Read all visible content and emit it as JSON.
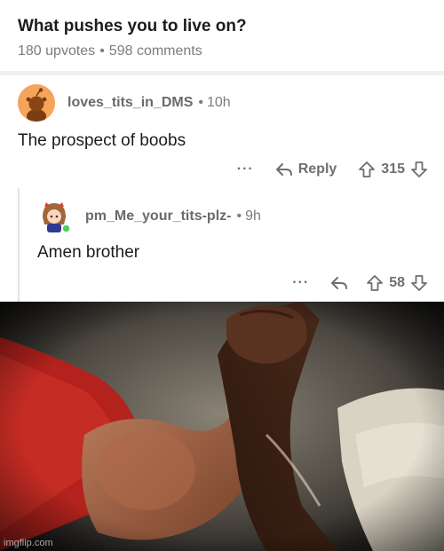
{
  "post": {
    "title": "What pushes you to live on?",
    "upvotes": "180 upvotes",
    "separator": "•",
    "comments": "598 comments"
  },
  "comments": [
    {
      "author": "loves_tits_in_DMS",
      "time": "10h",
      "body": "The prospect of boobs",
      "more": "···",
      "reply_label": "Reply",
      "votes": "315",
      "avatar_icon": "snoo-avatar-icon"
    },
    {
      "author": "pm_Me_your_tits-plz-",
      "time": "9h",
      "body": "Amen brother",
      "more": "···",
      "votes": "58",
      "avatar_icon": "anime-avatar-icon",
      "online": true
    }
  ],
  "meme": {
    "description": "epic handshake",
    "watermark": "imgflip.com"
  },
  "colors": {
    "meta_gray": "#7c7c7c",
    "author_gray": "#6a6a6a",
    "avatar_orange": "#f5a45b",
    "online_green": "#46d160"
  }
}
